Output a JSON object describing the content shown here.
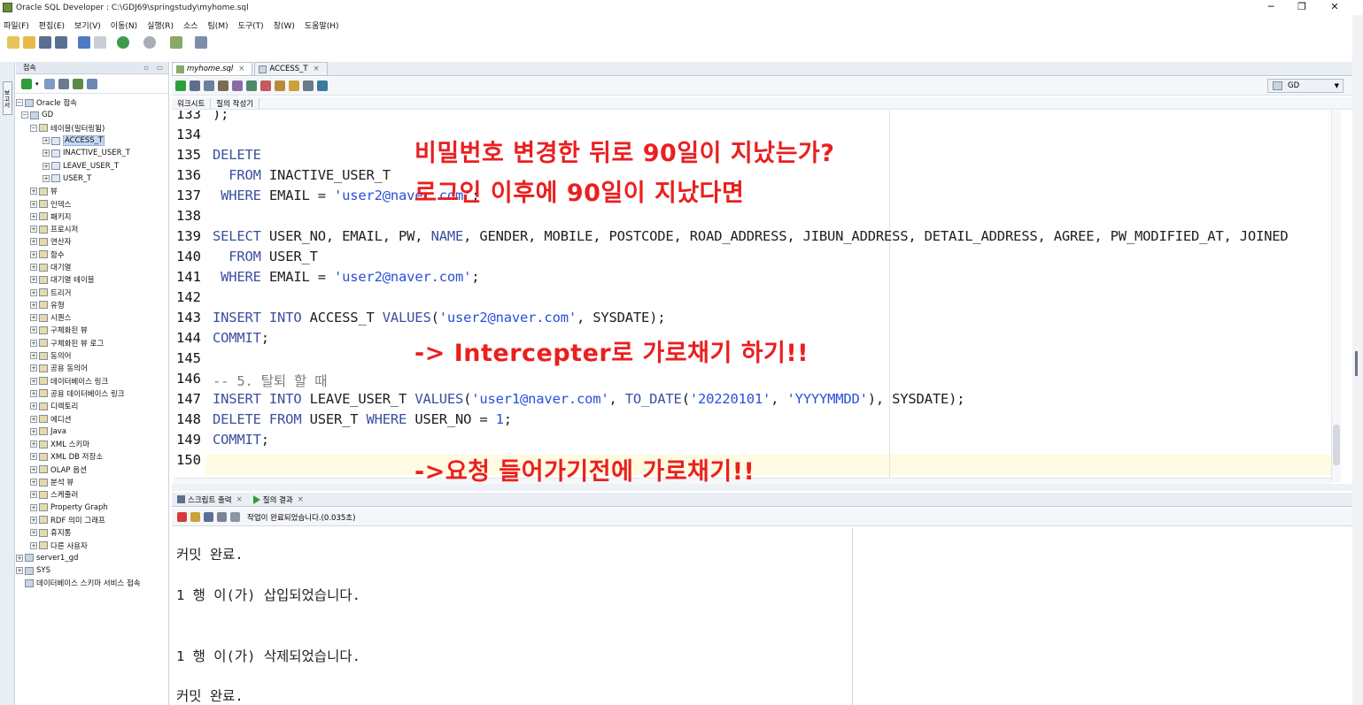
{
  "window": {
    "title": "Oracle SQL Developer : C:\\GDJ69\\springstudy\\myhome.sql",
    "controls": {
      "minimize": "─",
      "maximize": "❐",
      "close": "✕"
    }
  },
  "menu": [
    "파일(F)",
    "편집(E)",
    "보기(V)",
    "이동(N)",
    "실행(R)",
    "소스",
    "팀(M)",
    "도구(T)",
    "창(W)",
    "도움말(H)"
  ],
  "connections": {
    "title": "접속",
    "tree": [
      {
        "label": "Oracle 접속",
        "exp": "−"
      },
      {
        "label": "GD",
        "exp": "−"
      },
      {
        "label": "테이블(필터링됨)",
        "exp": "−"
      },
      {
        "label": "ACCESS_T",
        "exp": "+"
      },
      {
        "label": "INACTIVE_USER_T",
        "exp": "+"
      },
      {
        "label": "LEAVE_USER_T",
        "exp": "+"
      },
      {
        "label": "USER_T",
        "exp": "+"
      },
      {
        "label": "뷰",
        "exp": "+"
      },
      {
        "label": "인덱스",
        "exp": "+"
      },
      {
        "label": "패키지",
        "exp": "+"
      },
      {
        "label": "프로시저",
        "exp": "+"
      },
      {
        "label": "연산자",
        "exp": "+"
      },
      {
        "label": "함수",
        "exp": "+"
      },
      {
        "label": "대기열",
        "exp": "+"
      },
      {
        "label": "대기열 테이블",
        "exp": "+"
      },
      {
        "label": "트리거",
        "exp": "+"
      },
      {
        "label": "유형",
        "exp": "+"
      },
      {
        "label": "시퀀스",
        "exp": "+"
      },
      {
        "label": "구체화된 뷰",
        "exp": "+"
      },
      {
        "label": "구체화된 뷰 로그",
        "exp": "+"
      },
      {
        "label": "동의어",
        "exp": "+"
      },
      {
        "label": "공용 동의어",
        "exp": "+"
      },
      {
        "label": "데이터베이스 링크",
        "exp": "+"
      },
      {
        "label": "공용 데이터베이스 링크",
        "exp": "+"
      },
      {
        "label": "디렉토리",
        "exp": "+"
      },
      {
        "label": "에디션",
        "exp": "+"
      },
      {
        "label": "Java",
        "exp": "+"
      },
      {
        "label": "XML 스키마",
        "exp": "+"
      },
      {
        "label": "XML DB 저장소",
        "exp": "+"
      },
      {
        "label": "OLAP 옵션",
        "exp": "+"
      },
      {
        "label": "분석 뷰",
        "exp": "+"
      },
      {
        "label": "스케줄러",
        "exp": "+"
      },
      {
        "label": "Property Graph",
        "exp": "+"
      },
      {
        "label": "RDF 의미 그래프",
        "exp": "+"
      },
      {
        "label": "휴지통",
        "exp": "+"
      },
      {
        "label": "다른 사용자",
        "exp": "+"
      },
      {
        "label": "server1_gd",
        "exp": "+"
      },
      {
        "label": "SYS",
        "exp": "+"
      },
      {
        "label": "데이터베이스 스키마 서비스 접속",
        "exp": ""
      }
    ]
  },
  "editor": {
    "tabs": [
      {
        "label": "myhome.sql",
        "close": "×"
      },
      {
        "label": "ACCESS_T",
        "close": "×"
      }
    ],
    "connection": "GD",
    "subtabs": [
      "워크시트",
      "질의 작성기"
    ],
    "line_numbers": [
      "133",
      "134",
      "135",
      "136",
      "137",
      "138",
      "139",
      "140",
      "141",
      "142",
      "143",
      "144",
      "145",
      "146",
      "147",
      "148",
      "149",
      "150"
    ]
  },
  "annotations": {
    "note1": "비밀번호 변경한 뒤로 90일이 지났는가?",
    "note2": "로그인 이후에 90일이 지났다면",
    "note3": "-> Intercepter로 가로채기 하기!!",
    "note4": "->요청 들어가기전에 가로채기!!"
  },
  "output": {
    "tabs": [
      {
        "label": "스크립트 출력",
        "close": "×"
      },
      {
        "label": "질의 결과",
        "close": "×"
      }
    ],
    "status": "작업이 완료되었습니다.(0.035초)",
    "lines": [
      "커밋 완료.",
      "1 행 이(가) 삽입되었습니다.",
      "1 행 이(가) 삭제되었습니다.",
      "커밋 완료."
    ]
  },
  "colors": {
    "accent": "#ea1f1f",
    "keyword": "#3b4fa0",
    "string": "#2a4fd8"
  }
}
